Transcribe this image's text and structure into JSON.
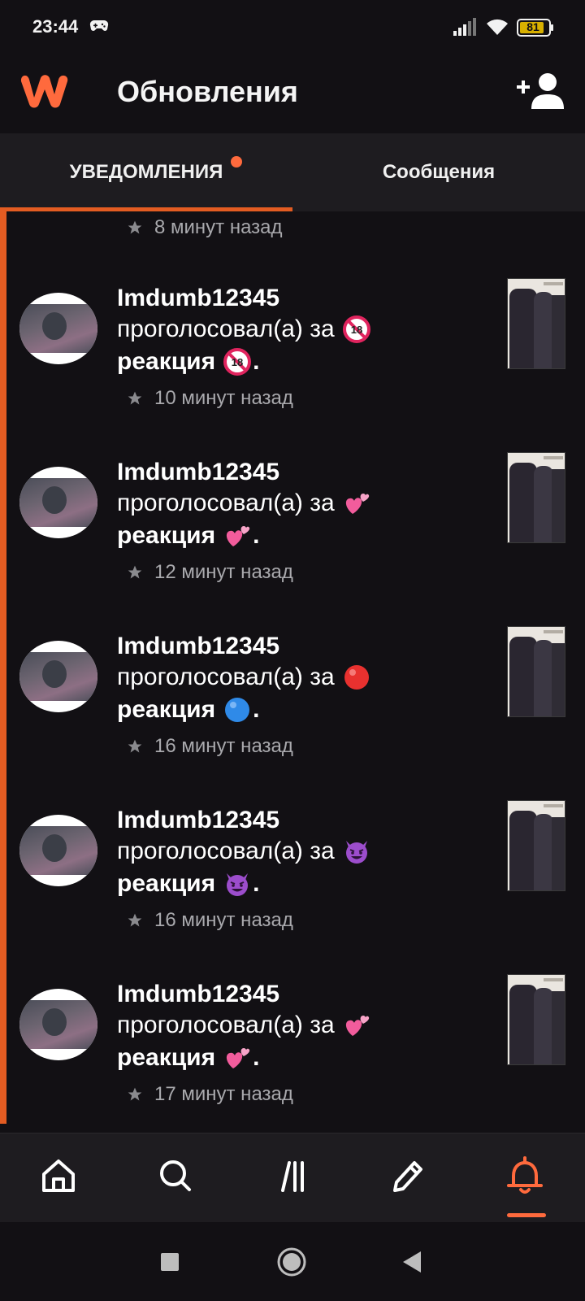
{
  "status_bar": {
    "time": "23:44",
    "battery": "81",
    "icons": [
      "gamepad-icon",
      "signal-icon",
      "wifi-icon",
      "battery-icon"
    ]
  },
  "header": {
    "title": "Обновления",
    "logo": "wattpad-logo",
    "action_icon": "add-user-icon",
    "accent_color": "#ff6a3d"
  },
  "tabs": [
    {
      "label": "УВЕДОМЛЕНИЯ",
      "active": true,
      "has_badge": true
    },
    {
      "label": "Сообщения",
      "active": false,
      "has_badge": false
    }
  ],
  "notifications": {
    "partial_item_time": "8 минут назад",
    "items": [
      {
        "username": "Imdumb12345",
        "action": "проголосовал(а) за",
        "emoji1": "🔞",
        "reaction_label": "реакция",
        "emoji2": "🔞",
        "time": "10 минут назад"
      },
      {
        "username": "Imdumb12345",
        "action": "проголосовал(а) за",
        "emoji1": "💞",
        "reaction_label": "реакция",
        "emoji2": "💞",
        "time": "12 минут назад"
      },
      {
        "username": "Imdumb12345",
        "action": "проголосовал(а) за",
        "emoji1": "🔴",
        "reaction_label": "реакция",
        "emoji2": "🔵",
        "time": "16 минут назад"
      },
      {
        "username": "Imdumb12345",
        "action": "проголосовал(а) за",
        "emoji1": "😈",
        "reaction_label": "реакция",
        "emoji2": "😈",
        "time": "16 минут назад"
      },
      {
        "username": "Imdumb12345",
        "action": "проголосовал(а) за",
        "emoji1": "💞",
        "reaction_label": "реакция",
        "emoji2": "💞",
        "time": "17 минут назад"
      }
    ]
  },
  "bottom_nav": {
    "items": [
      "home-icon",
      "search-icon",
      "library-icon",
      "write-icon",
      "notifications-icon"
    ],
    "active": "notifications-icon"
  },
  "system_nav": [
    "recents-button",
    "home-button",
    "back-button"
  ]
}
